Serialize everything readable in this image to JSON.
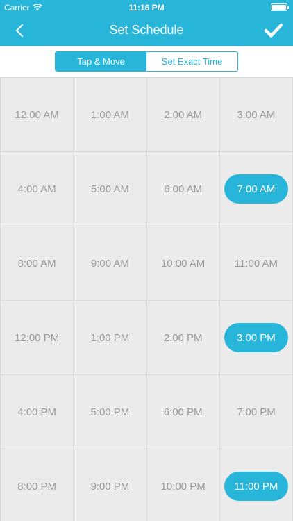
{
  "status_bar": {
    "carrier": "Carrier",
    "time": "11:16 PM"
  },
  "nav": {
    "title": "Set Schedule",
    "back_icon": "chevron-left-icon",
    "confirm_icon": "checkmark-icon"
  },
  "segments": [
    {
      "label": "Tap & Move",
      "active": true
    },
    {
      "label": "Set Exact Time",
      "active": false
    }
  ],
  "accent_color": "#27b6d9",
  "times": [
    {
      "label": "12:00 AM",
      "selected": false
    },
    {
      "label": "1:00 AM",
      "selected": false
    },
    {
      "label": "2:00 AM",
      "selected": false
    },
    {
      "label": "3:00 AM",
      "selected": false
    },
    {
      "label": "4:00 AM",
      "selected": false
    },
    {
      "label": "5:00 AM",
      "selected": false
    },
    {
      "label": "6:00 AM",
      "selected": false
    },
    {
      "label": "7:00 AM",
      "selected": true
    },
    {
      "label": "8:00 AM",
      "selected": false
    },
    {
      "label": "9:00 AM",
      "selected": false
    },
    {
      "label": "10:00 AM",
      "selected": false
    },
    {
      "label": "11:00 AM",
      "selected": false
    },
    {
      "label": "12:00 PM",
      "selected": false
    },
    {
      "label": "1:00 PM",
      "selected": false
    },
    {
      "label": "2:00 PM",
      "selected": false
    },
    {
      "label": "3:00 PM",
      "selected": true
    },
    {
      "label": "4:00 PM",
      "selected": false
    },
    {
      "label": "5:00 PM",
      "selected": false
    },
    {
      "label": "6:00 PM",
      "selected": false
    },
    {
      "label": "7:00 PM",
      "selected": false
    },
    {
      "label": "8:00 PM",
      "selected": false
    },
    {
      "label": "9:00 PM",
      "selected": false
    },
    {
      "label": "10:00 PM",
      "selected": false
    },
    {
      "label": "11:00 PM",
      "selected": true
    }
  ]
}
